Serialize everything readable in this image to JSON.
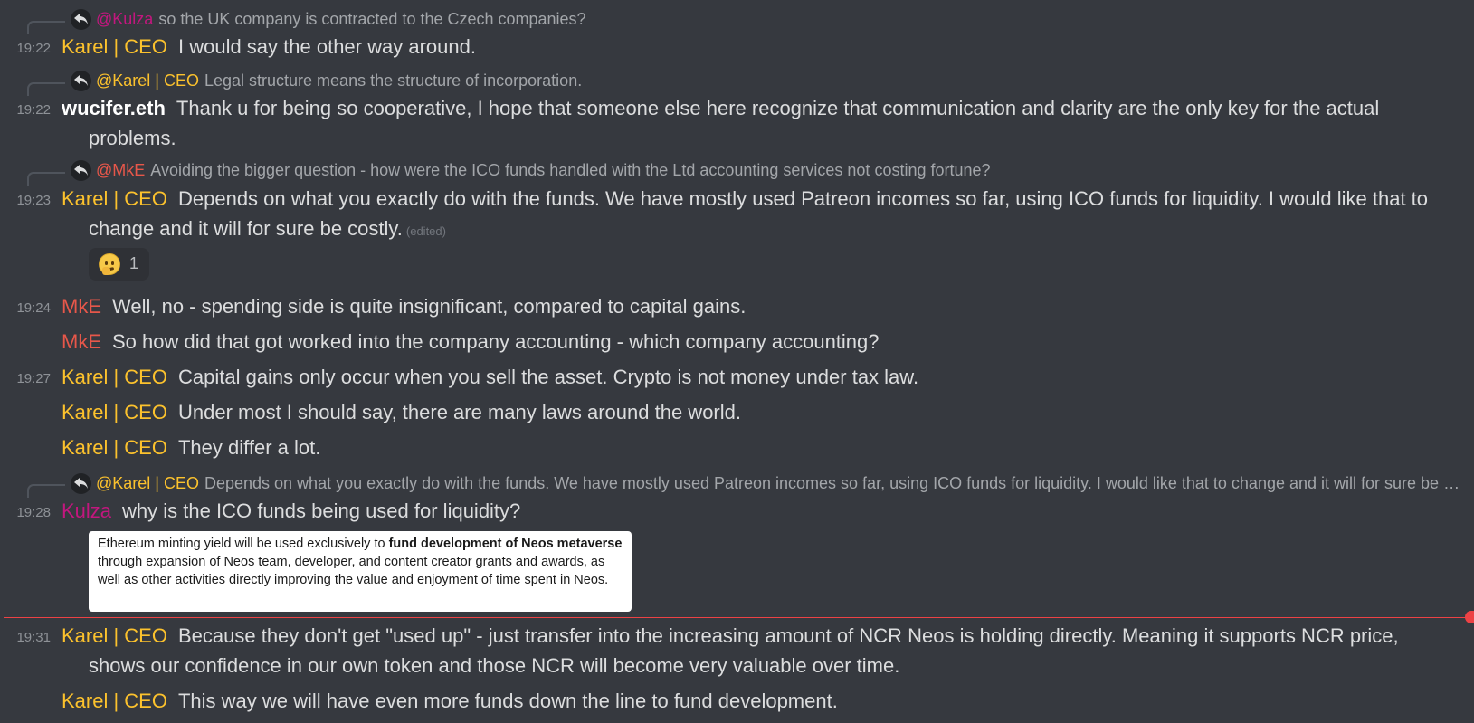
{
  "colors": {
    "karel": "#fcc22d",
    "mke": "#e7574a",
    "kulza": "#c2177e",
    "wucifer": "#ffffff",
    "text": "#dcddde",
    "muted": "#a3a6aa",
    "new_divider": "#ed4245"
  },
  "icons": {
    "reply": "reply-arrow-icon",
    "reaction_emoji": "thinking-face-emoji"
  },
  "messages": [
    {
      "reply": {
        "mention": "@Kulza",
        "text": "so the UK company is contracted to the Czech companies?"
      },
      "time": "19:22",
      "author": "Karel | CEO",
      "lines": [
        "I would say the other way around."
      ]
    },
    {
      "reply": {
        "mention": "@Karel | CEO",
        "text": "Legal structure means the structure of incorporation."
      },
      "time": "19:22",
      "author": "wucifer.eth",
      "lines": [
        "Thank u for being so cooperative, I hope that someone else here recognize that communication and clarity are the only key for the actual",
        "problems."
      ]
    },
    {
      "reply": {
        "mention": "@MkE",
        "text": "Avoiding the bigger question - how were the ICO funds handled with the Ltd accounting services not costing fortune?"
      },
      "time": "19:23",
      "author": "Karel | CEO",
      "lines": [
        "Depends on what you exactly do with the funds. We have mostly used Patreon incomes so far, using ICO funds for liquidity. I would like that to",
        "change and it will for sure be costly."
      ],
      "edited": "(edited)",
      "reaction_count": "1"
    },
    {
      "time": "19:24",
      "author": "MkE",
      "text": "Well, no - spending side is quite insignificant, compared to capital gains."
    },
    {
      "author": "MkE",
      "text": "So how did that got worked into the company accounting - which company accounting?"
    },
    {
      "time": "19:27",
      "author": "Karel | CEO",
      "text": "Capital gains only occur when you sell the asset. Crypto is not money under tax law."
    },
    {
      "author": "Karel | CEO",
      "text": "Under most I should say, there are many laws around the world."
    },
    {
      "author": "Karel | CEO",
      "text": "They differ a lot."
    },
    {
      "reply": {
        "mention": "@Karel | CEO",
        "text": "Depends on what you exactly do with the funds. We have mostly used Patreon incomes so far, using ICO funds for liquidity. I would like that to change and it will for sure be costly."
      },
      "time": "19:28",
      "author": "Kulza",
      "text": "why is the ICO funds being used for liquidity?",
      "embed": {
        "pre": "Ethereum minting yield will be used exclusively to ",
        "bold": "fund development of Neos metaverse",
        "post": " through expansion of Neos team, developer, and content creator grants and awards, as well as other activities directly improving the value and enjoyment of time spent in Neos."
      }
    },
    {
      "time": "19:31",
      "author": "Karel | CEO",
      "lines": [
        "Because they don't get \"used up\" - just transfer into the increasing amount of NCR Neos is holding directly. Meaning it supports NCR price,",
        "shows our confidence in our own token and those NCR will become very valuable over time."
      ]
    },
    {
      "author": "Karel | CEO",
      "text": "This way we will have even more funds down the line to fund development."
    }
  ]
}
